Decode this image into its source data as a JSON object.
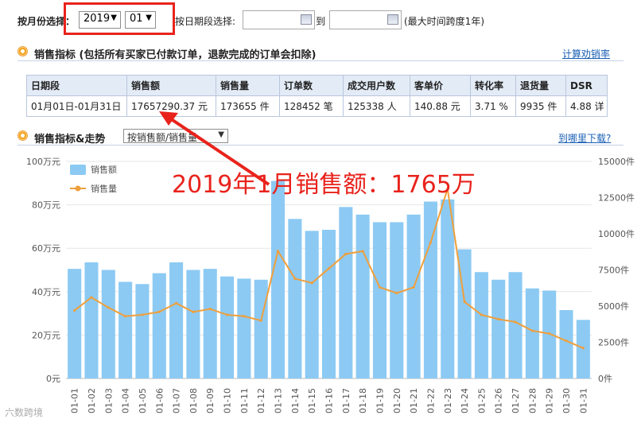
{
  "filter": {
    "month_label": "按月份选择：",
    "year": "2019",
    "month": "01",
    "date_label": "按日期段选择:",
    "to_label": "到",
    "hint": "(最大时间跨度1年)"
  },
  "section1": {
    "title": "销售指标 (包括所有买家已付款订单，退款完成的订单会扣除)",
    "link": "计算劝销率",
    "headers": [
      "日期段",
      "销售额",
      "销售量",
      "订单数",
      "成交用户数",
      "客单价",
      "转化率",
      "退货量",
      "DSR"
    ],
    "row": [
      "01月01日-01月31日",
      "17657290.37  元",
      "173655  件",
      "128452  笔",
      "125338  人",
      "140.88  元",
      "3.71  %",
      "9935  件",
      "4.88  详"
    ]
  },
  "section2": {
    "title": "销售指标&走势",
    "mode": "按销售额/销售量",
    "link": "到哪里下载?"
  },
  "annotation": "2019年1月销售额：1765万",
  "watermark": "六数跨境",
  "colors": {
    "bar": "#8ccaf3",
    "line": "#ef9f3c",
    "red": "#e8231c",
    "link": "#1a5fb4"
  },
  "chart_data": {
    "type": "bar",
    "categories": [
      "01-01",
      "01-02",
      "01-03",
      "01-04",
      "01-05",
      "01-06",
      "01-07",
      "01-08",
      "01-09",
      "01-10",
      "01-11",
      "01-12",
      "01-13",
      "01-14",
      "01-15",
      "01-16",
      "01-17",
      "01-18",
      "01-19",
      "01-20",
      "01-21",
      "01-22",
      "01-23",
      "01-24",
      "01-25",
      "01-26",
      "01-27",
      "01-28",
      "01-29",
      "01-30",
      "01-31"
    ],
    "series": [
      {
        "name": "销售额",
        "axis": "left",
        "values": [
          50.5,
          53.5,
          50,
          44.5,
          43.5,
          48.5,
          53.5,
          50,
          50.5,
          47,
          46,
          45.5,
          91,
          73.5,
          68,
          68.5,
          79,
          75.5,
          72,
          72,
          75.5,
          81.5,
          82.5,
          59.5,
          49,
          45.5,
          49,
          41.5,
          40.5,
          31.5,
          27
        ]
      },
      {
        "name": "销售量",
        "axis": "right",
        "values": [
          4700,
          5600,
          4900,
          4300,
          4400,
          4600,
          5200,
          4600,
          4800,
          4400,
          4300,
          4000,
          8800,
          6900,
          6600,
          7600,
          8600,
          8800,
          6300,
          5900,
          6300,
          9400,
          13100,
          5300,
          4400,
          4100,
          3900,
          3300,
          3100,
          2600,
          2100
        ]
      }
    ],
    "left_axis": {
      "ticks": [
        "0元",
        "20万元",
        "40万元",
        "60万元",
        "80万元",
        "100万元"
      ],
      "ylim": [
        0,
        100
      ]
    },
    "right_axis": {
      "ticks": [
        "0件",
        "2500件",
        "5000件",
        "7500件",
        "10000件",
        "12500件",
        "15000件"
      ],
      "ylim": [
        0,
        15000
      ]
    },
    "legend_position": "top-left",
    "grid": true
  }
}
